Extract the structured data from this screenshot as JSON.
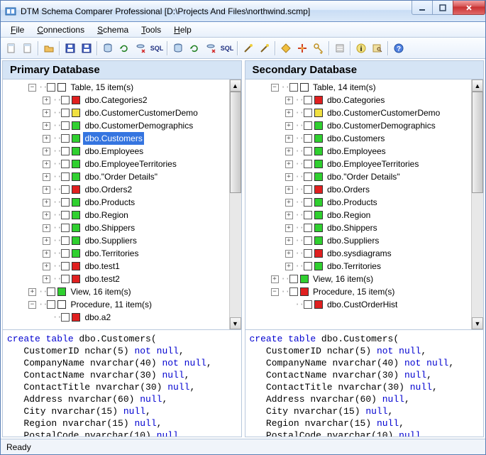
{
  "window": {
    "title": "DTM Schema Comparer Professional [D:\\Projects And Files\\northwind.scmp]"
  },
  "menu": [
    "File",
    "Connections",
    "Schema",
    "Tools",
    "Help"
  ],
  "status": "Ready",
  "panes": {
    "primary": {
      "title": "Primary Database",
      "nodes": [
        {
          "d": 1,
          "exp": "-",
          "c": "white",
          "t": "Table, 15 item(s)",
          "sel": false
        },
        {
          "d": 2,
          "exp": "+",
          "c": "red",
          "t": "dbo.Categories2"
        },
        {
          "d": 2,
          "exp": "+",
          "c": "yellow",
          "t": "dbo.CustomerCustomerDemo"
        },
        {
          "d": 2,
          "exp": "+",
          "c": "green",
          "t": "dbo.CustomerDemographics"
        },
        {
          "d": 2,
          "exp": "+",
          "c": "green",
          "t": "dbo.Customers",
          "sel": true
        },
        {
          "d": 2,
          "exp": "+",
          "c": "green",
          "t": "dbo.Employees"
        },
        {
          "d": 2,
          "exp": "+",
          "c": "green",
          "t": "dbo.EmployeeTerritories"
        },
        {
          "d": 2,
          "exp": "+",
          "c": "green",
          "t": "dbo.\"Order Details\""
        },
        {
          "d": 2,
          "exp": "+",
          "c": "red",
          "t": "dbo.Orders2"
        },
        {
          "d": 2,
          "exp": "+",
          "c": "green",
          "t": "dbo.Products"
        },
        {
          "d": 2,
          "exp": "+",
          "c": "green",
          "t": "dbo.Region"
        },
        {
          "d": 2,
          "exp": "+",
          "c": "green",
          "t": "dbo.Shippers"
        },
        {
          "d": 2,
          "exp": "+",
          "c": "green",
          "t": "dbo.Suppliers"
        },
        {
          "d": 2,
          "exp": "+",
          "c": "green",
          "t": "dbo.Territories"
        },
        {
          "d": 2,
          "exp": "+",
          "c": "red",
          "t": "dbo.test1"
        },
        {
          "d": 2,
          "exp": "+",
          "c": "red",
          "t": "dbo.test2"
        },
        {
          "d": 1,
          "exp": "+",
          "c": "green",
          "t": "View, 16 item(s)"
        },
        {
          "d": 1,
          "exp": "-",
          "c": "white",
          "t": "Procedure, 11 item(s)"
        },
        {
          "d": 2,
          "exp": " ",
          "c": "red",
          "t": "dbo.a2"
        }
      ],
      "sql": [
        [
          "kw",
          "create table"
        ],
        [
          "tk",
          " dbo.Customers(\n   CustomerID nchar(5) "
        ],
        [
          "kw",
          "not null"
        ],
        [
          "tk",
          ",\n   CompanyName nvarchar(40) "
        ],
        [
          "kw",
          "not null"
        ],
        [
          "tk",
          ",\n   ContactName nvarchar(30) "
        ],
        [
          "kw",
          "null"
        ],
        [
          "tk",
          ",\n   ContactTitle nvarchar(30) "
        ],
        [
          "kw",
          "null"
        ],
        [
          "tk",
          ",\n   Address nvarchar(60) "
        ],
        [
          "kw",
          "null"
        ],
        [
          "tk",
          ",\n   City nvarchar(15) "
        ],
        [
          "kw",
          "null"
        ],
        [
          "tk",
          ",\n   Region nvarchar(15) "
        ],
        [
          "kw",
          "null"
        ],
        [
          "tk",
          ",\n   PostalCode nvarchar(10) "
        ],
        [
          "kw",
          "null"
        ],
        [
          "tk",
          ","
        ]
      ]
    },
    "secondary": {
      "title": "Secondary Database",
      "nodes": [
        {
          "d": 1,
          "exp": "-",
          "c": "white",
          "t": "Table, 14 item(s)"
        },
        {
          "d": 2,
          "exp": "+",
          "c": "red",
          "t": "dbo.Categories"
        },
        {
          "d": 2,
          "exp": "+",
          "c": "yellow",
          "t": "dbo.CustomerCustomerDemo"
        },
        {
          "d": 2,
          "exp": "+",
          "c": "green",
          "t": "dbo.CustomerDemographics"
        },
        {
          "d": 2,
          "exp": "+",
          "c": "green",
          "t": "dbo.Customers"
        },
        {
          "d": 2,
          "exp": "+",
          "c": "green",
          "t": "dbo.Employees"
        },
        {
          "d": 2,
          "exp": "+",
          "c": "green",
          "t": "dbo.EmployeeTerritories"
        },
        {
          "d": 2,
          "exp": "+",
          "c": "green",
          "t": "dbo.\"Order Details\""
        },
        {
          "d": 2,
          "exp": "+",
          "c": "red",
          "t": "dbo.Orders"
        },
        {
          "d": 2,
          "exp": "+",
          "c": "green",
          "t": "dbo.Products"
        },
        {
          "d": 2,
          "exp": "+",
          "c": "green",
          "t": "dbo.Region"
        },
        {
          "d": 2,
          "exp": "+",
          "c": "green",
          "t": "dbo.Shippers"
        },
        {
          "d": 2,
          "exp": "+",
          "c": "green",
          "t": "dbo.Suppliers"
        },
        {
          "d": 2,
          "exp": "+",
          "c": "red",
          "t": "dbo.sysdiagrams"
        },
        {
          "d": 2,
          "exp": "+",
          "c": "green",
          "t": "dbo.Territories"
        },
        {
          "d": 1,
          "exp": "+",
          "c": "green",
          "t": "View, 16 item(s)"
        },
        {
          "d": 1,
          "exp": "-",
          "c": "red",
          "t": "Procedure, 15 item(s)"
        },
        {
          "d": 2,
          "exp": " ",
          "c": "red",
          "t": "dbo.CustOrderHist"
        }
      ],
      "sql": [
        [
          "kw",
          "create table"
        ],
        [
          "tk",
          " dbo.Customers(\n   CustomerID nchar(5) "
        ],
        [
          "kw",
          "not null"
        ],
        [
          "tk",
          ",\n   CompanyName nvarchar(40) "
        ],
        [
          "kw",
          "not null"
        ],
        [
          "tk",
          ",\n   ContactName nvarchar(30) "
        ],
        [
          "kw",
          "null"
        ],
        [
          "tk",
          ",\n   ContactTitle nvarchar(30) "
        ],
        [
          "kw",
          "null"
        ],
        [
          "tk",
          ",\n   Address nvarchar(60) "
        ],
        [
          "kw",
          "null"
        ],
        [
          "tk",
          ",\n   City nvarchar(15) "
        ],
        [
          "kw",
          "null"
        ],
        [
          "tk",
          ",\n   Region nvarchar(15) "
        ],
        [
          "kw",
          "null"
        ],
        [
          "tk",
          ",\n   PostalCode nvarchar(10) "
        ],
        [
          "kw",
          "null"
        ],
        [
          "tk",
          ","
        ]
      ]
    }
  },
  "toolbar_icons": [
    "new-file-icon",
    "new-doc-icon",
    "sep",
    "open-icon",
    "sep",
    "save-icon",
    "save-as-icon",
    "sep",
    "db1-icon",
    "refresh1-icon",
    "x1-icon",
    "sql1-icon",
    "sep",
    "db2-icon",
    "refresh2-icon",
    "x2-icon",
    "sql2-icon",
    "sep",
    "wand-icon",
    "wand2-icon",
    "sep",
    "diamond-icon",
    "nav-icon",
    "key-icon",
    "sep",
    "filter-icon",
    "sep",
    "info-icon",
    "find-icon",
    "sep",
    "help-icon"
  ]
}
